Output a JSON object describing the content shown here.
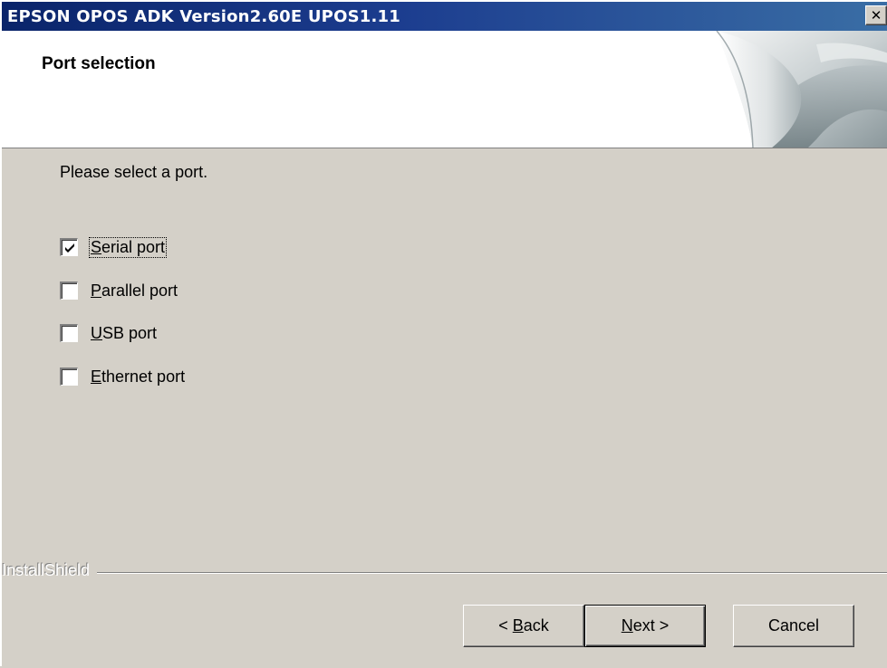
{
  "window": {
    "title": "EPSON OPOS ADK Version2.60E UPOS1.11",
    "close_glyph": "✕"
  },
  "header": {
    "title": "Port selection",
    "graphic": "page-curl-graphic"
  },
  "content": {
    "instruction": "Please select a port.",
    "ports": [
      {
        "mnemonic": "S",
        "rest": "erial port",
        "checked": true
      },
      {
        "mnemonic": "P",
        "rest": "arallel port",
        "checked": false
      },
      {
        "mnemonic": "U",
        "rest": "SB port",
        "checked": false
      },
      {
        "mnemonic": "E",
        "rest": "thernet port",
        "checked": false
      }
    ]
  },
  "footer": {
    "brand": "InstallShield",
    "back_prefix": "< ",
    "back_mnemonic": "B",
    "back_rest": "ack",
    "next_mnemonic": "N",
    "next_rest": "ext >",
    "cancel": "Cancel"
  },
  "colors": {
    "titlebar_start": "#0a246a",
    "titlebar_end": "#3a6ea5",
    "dialog_bg": "#d4d0c8"
  }
}
